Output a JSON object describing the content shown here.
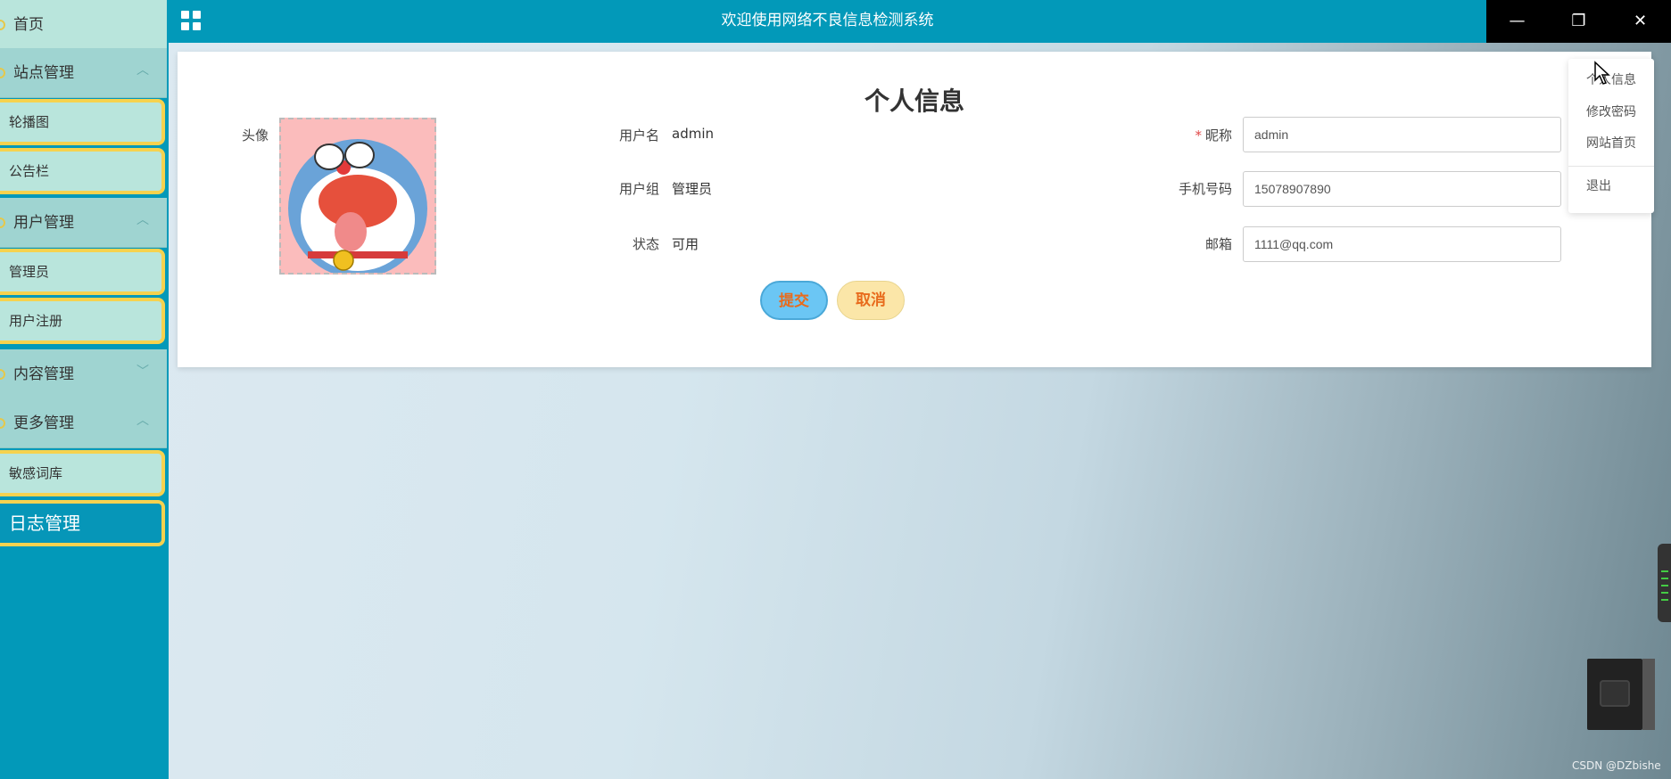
{
  "header": {
    "title": "欢迎使用网络不良信息检测系统"
  },
  "window": {
    "minimize": "—",
    "restore": "❐",
    "close": "✕"
  },
  "sidebar": {
    "home": "首页",
    "groups": [
      {
        "label": "站点管理",
        "items": [
          "轮播图",
          "公告栏"
        ]
      },
      {
        "label": "用户管理",
        "items": [
          "管理员",
          "用户注册"
        ]
      },
      {
        "label": "内容管理",
        "items": []
      },
      {
        "label": "更多管理",
        "items": [
          "敏感词库"
        ]
      }
    ],
    "active_item": "日志管理"
  },
  "form": {
    "title": "个人信息",
    "avatar_label": "头像",
    "username_label": "用户名",
    "username_value": "admin",
    "group_label": "用户组",
    "group_value": "管理员",
    "status_label": "状态",
    "status_value": "可用",
    "nickname_required": "*",
    "nickname_label": "昵称",
    "nickname_value": "admin",
    "phone_label": "手机号码",
    "phone_value": "15078907890",
    "email_label": "邮箱",
    "email_value": "1111@qq.com",
    "submit_label": "提交",
    "cancel_label": "取消"
  },
  "dropdown": {
    "items": [
      "个人信息",
      "修改密码",
      "网站首页"
    ],
    "logout": "退出"
  },
  "watermark": "CSDN @DZbishe",
  "colors": {
    "primary": "#0299b9",
    "sidebar_item_bg": "#b9e5dc",
    "sidebar_item_border": "#f6d24e",
    "submit_bg": "#6bc6f4",
    "cancel_bg": "#fbe6a8",
    "button_text": "#e86b1c"
  }
}
